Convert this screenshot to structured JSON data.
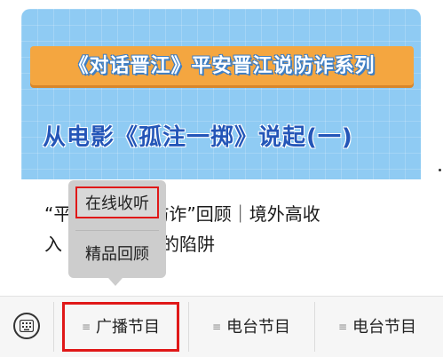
{
  "article": {
    "banner_series": "《对话晋江》平安晋江说防诈系列",
    "banner_episode": "从电影《孤注一掷》说起(一)",
    "title_line1_start": "“平",
    "title_line1_end": "防诈”回顾｜境外高收",
    "title_line2_start": "入",
    "title_line2_end": "的陷阱"
  },
  "popup_menu": {
    "items": [
      "在线收听",
      "精品回顾"
    ],
    "highlighted_index": 0
  },
  "bottom_bar": {
    "keyboard_icon": "keyboard-icon",
    "menus": [
      {
        "label": "广播节目",
        "icon": "menu-lines-icon",
        "active": true
      },
      {
        "label": "电台节目",
        "icon": "menu-lines-icon",
        "active": false
      },
      {
        "label": "电台节目",
        "icon": "menu-lines-icon",
        "active": false
      }
    ]
  },
  "colors": {
    "highlight_border": "#e01818",
    "banner_bg": "#8fcbf3",
    "banner_tag": "#f4a640",
    "episode_text": "#2456b8"
  }
}
